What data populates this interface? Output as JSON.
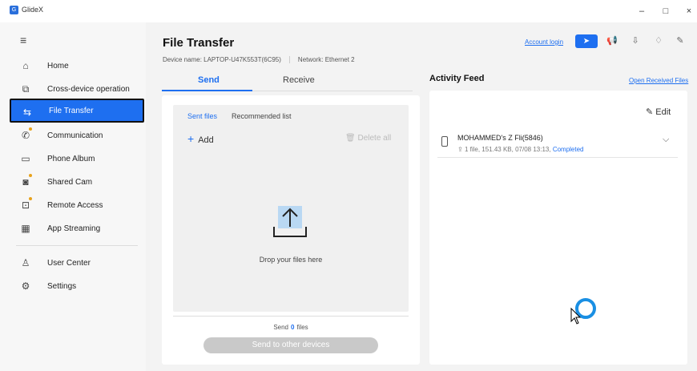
{
  "window": {
    "app_name": "GlideX",
    "logo_glyph": "G",
    "minimize": "–",
    "maximize": "□",
    "close": "×"
  },
  "sidebar": {
    "items": [
      {
        "label": "Home",
        "icon": "home-icon"
      },
      {
        "label": "Cross-device operation",
        "icon": "cross-device-icon"
      },
      {
        "label": "File Transfer",
        "icon": "file-transfer-icon"
      },
      {
        "label": "Communication",
        "icon": "phone-call-icon"
      },
      {
        "label": "Phone Album",
        "icon": "album-icon"
      },
      {
        "label": "Shared Cam",
        "icon": "camera-icon"
      },
      {
        "label": "Remote Access",
        "icon": "remote-access-icon"
      },
      {
        "label": "App Streaming",
        "icon": "app-grid-icon"
      },
      {
        "label": "User Center",
        "icon": "user-icon"
      },
      {
        "label": "Settings",
        "icon": "gear-icon"
      }
    ]
  },
  "header": {
    "title": "File Transfer",
    "device_name": "Device name: LAPTOP-U47K553T(6C95)",
    "network": "Network: Ethernet 2",
    "account_login": "Account login"
  },
  "send": {
    "tabs": {
      "send": "Send",
      "receive": "Receive"
    },
    "subtabs": {
      "sent": "Sent files",
      "recommended": "Recommended list"
    },
    "add_label": "Add",
    "delete_all": "Delete all",
    "drop_text": "Drop your files here",
    "count_prefix": "Send",
    "count": "0",
    "count_suffix": "files",
    "send_button": "Send to other devices"
  },
  "activity": {
    "title": "Activity Feed",
    "open_received": "Open Received Files",
    "edit": "Edit",
    "items": [
      {
        "device": "MOHAMMED's Z Fli(5846)",
        "detail": "1 file, 151.43 KB, 07/08 13:13,",
        "status": "Completed"
      }
    ]
  },
  "colors": {
    "accent": "#1e6ff0",
    "sidebar_bg": "#f7f7f7",
    "main_bg": "#f3f3f3"
  }
}
